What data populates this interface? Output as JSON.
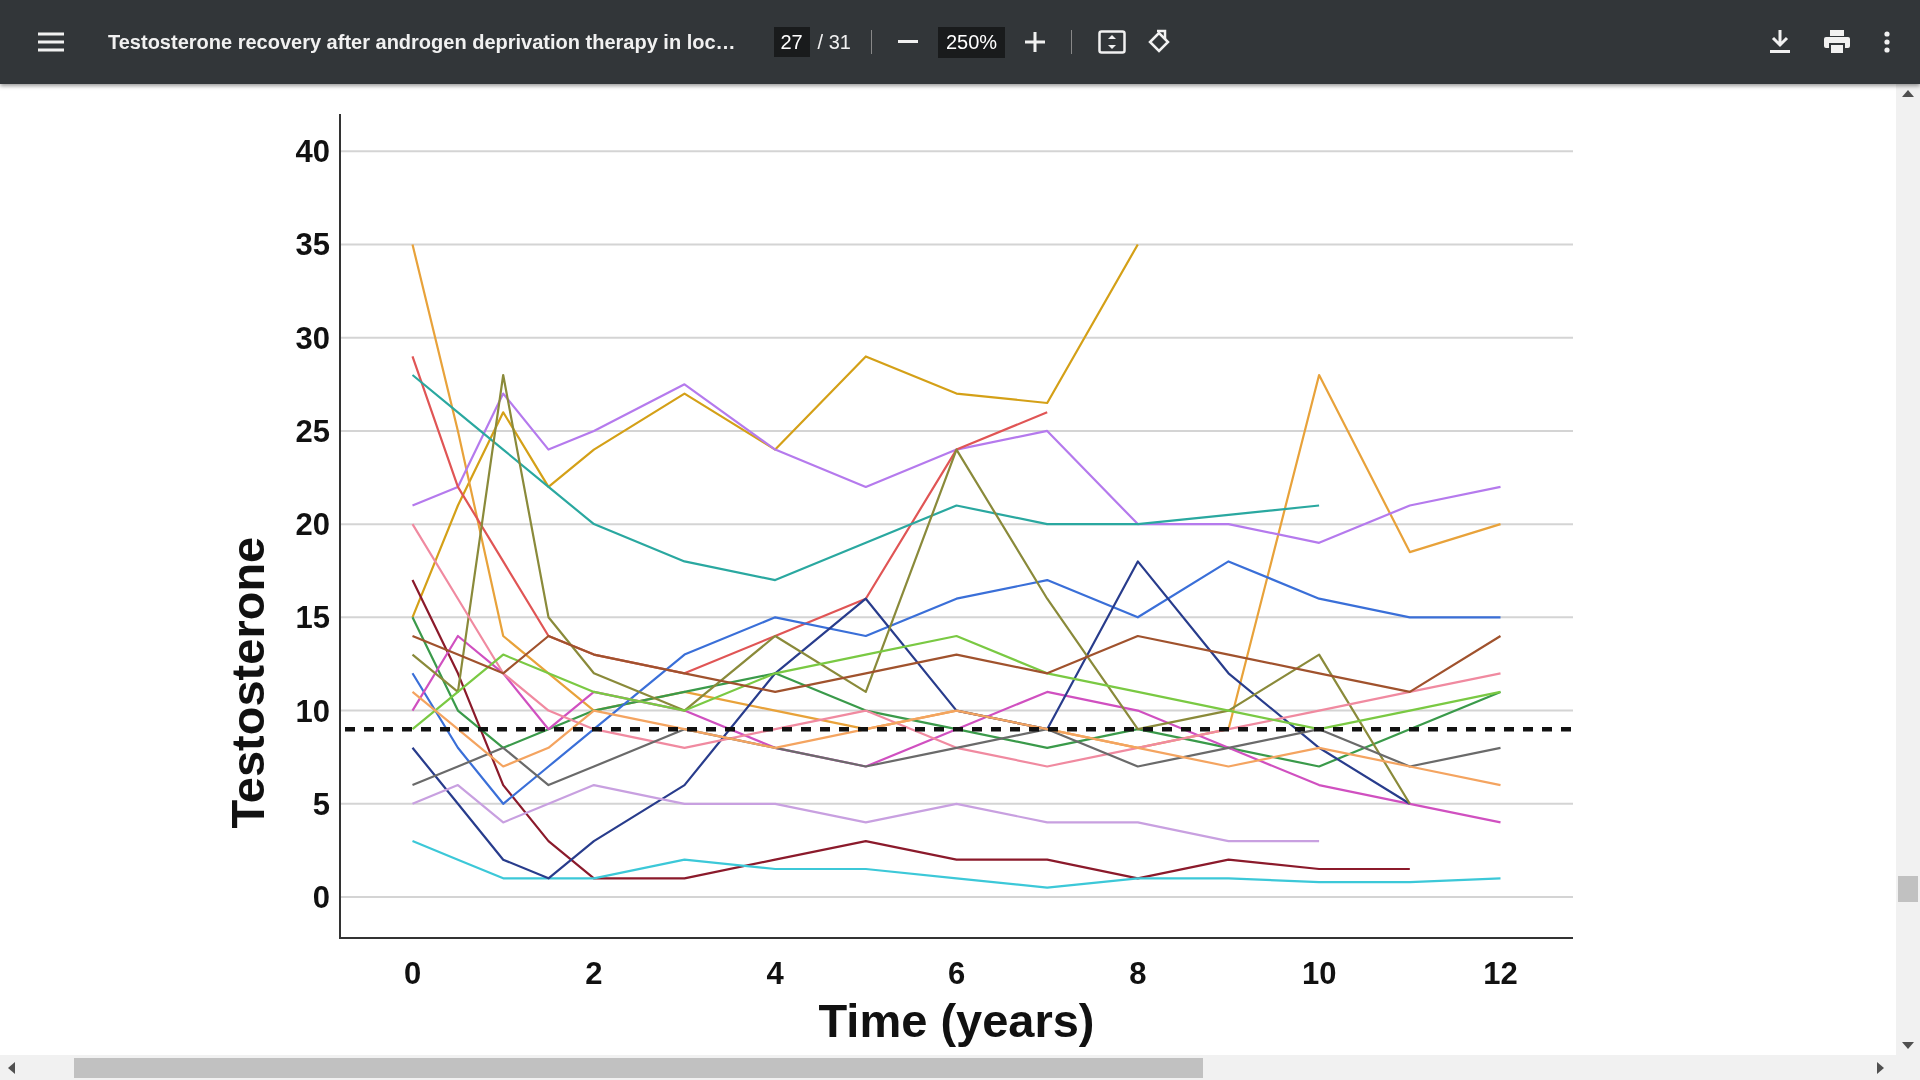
{
  "toolbar": {
    "title": "Testosterone recovery after androgen deprivation therapy in loc…",
    "page_number": "27",
    "page_count": "/ 31",
    "zoom": "250%"
  },
  "document": {
    "chart_data": {
      "type": "line",
      "xlabel": "Time (years)",
      "ylabel": "Testosterone",
      "x": [
        0,
        0.5,
        1,
        1.5,
        2,
        3,
        4,
        5,
        6,
        7,
        8,
        9,
        10,
        11,
        12
      ],
      "xticks": [
        0,
        2,
        4,
        6,
        8,
        10,
        12
      ],
      "yticks": [
        0,
        5,
        10,
        15,
        20,
        25,
        30,
        35,
        40
      ],
      "xlim": [
        -0.8,
        12.8
      ],
      "ylim": [
        -2.2,
        42
      ],
      "series": [
        {
          "color": "#d4a017",
          "values": [
            15,
            21,
            26,
            22,
            24,
            27,
            24,
            29,
            27,
            26.5,
            35,
            null,
            null,
            null,
            null
          ]
        },
        {
          "color": "#e8a23a",
          "values": [
            35,
            25,
            14,
            12,
            10,
            11,
            10,
            9,
            10,
            9,
            8,
            9,
            28,
            18.5,
            20
          ]
        },
        {
          "color": "#b57aed",
          "values": [
            21,
            22,
            27,
            24,
            25,
            27.5,
            24,
            22,
            24,
            25,
            20,
            20,
            19,
            21,
            22
          ]
        },
        {
          "color": "#e05555",
          "values": [
            29,
            22,
            18,
            14,
            13,
            12,
            14,
            16,
            24,
            26,
            null,
            null,
            null,
            null,
            null
          ]
        },
        {
          "color": "#2aa8a0",
          "values": [
            28,
            26,
            24,
            22,
            20,
            18,
            17,
            19,
            21,
            20,
            20,
            20.5,
            21,
            null,
            null
          ]
        },
        {
          "color": "#8b1a2b",
          "values": [
            17,
            12,
            6,
            3,
            1,
            1,
            2,
            3,
            2,
            2,
            1,
            2,
            1.5,
            1.5,
            null
          ]
        },
        {
          "color": "#3cc8d8",
          "values": [
            3,
            2,
            1,
            1,
            1,
            2,
            1.5,
            1.5,
            1,
            0.5,
            1,
            1,
            0.8,
            0.8,
            1
          ]
        },
        {
          "color": "#3a9a4a",
          "values": [
            15,
            10,
            8,
            9,
            10,
            11,
            12,
            10,
            9,
            8,
            9,
            8,
            7,
            9,
            11
          ]
        },
        {
          "color": "#3a6fd8",
          "values": [
            12,
            8,
            5,
            7,
            9,
            13,
            15,
            14,
            16,
            17,
            15,
            18,
            16,
            15,
            15
          ]
        },
        {
          "color": "#d050c0",
          "values": [
            10,
            14,
            12,
            9,
            11,
            10,
            8,
            7,
            9,
            11,
            10,
            8,
            6,
            5,
            4
          ]
        },
        {
          "color": "#283c8c",
          "values": [
            8,
            5,
            2,
            1,
            3,
            6,
            12,
            16,
            10,
            9,
            18,
            12,
            8,
            5,
            null
          ]
        },
        {
          "color": "#8a8a3a",
          "values": [
            13,
            11,
            28,
            15,
            12,
            10,
            14,
            11,
            24,
            16,
            9,
            10,
            13,
            5,
            null
          ]
        },
        {
          "color": "#f08aa0",
          "values": [
            20,
            16,
            12,
            10,
            9,
            8,
            9,
            10,
            8,
            7,
            8,
            9,
            10,
            11,
            12
          ]
        },
        {
          "color": "#6a6a6a",
          "values": [
            6,
            7,
            8,
            6,
            7,
            9,
            8,
            7,
            8,
            9,
            7,
            8,
            9,
            7,
            8
          ]
        },
        {
          "color": "#7ac943",
          "values": [
            9,
            11,
            13,
            12,
            11,
            10,
            12,
            13,
            14,
            12,
            11,
            10,
            9,
            10,
            11
          ]
        },
        {
          "color": "#a0522d",
          "values": [
            14,
            13,
            12,
            14,
            13,
            12,
            11,
            12,
            13,
            12,
            14,
            13,
            12,
            11,
            14
          ]
        },
        {
          "color": "#c8a0e0",
          "values": [
            5,
            6,
            4,
            5,
            6,
            5,
            5,
            4,
            5,
            4,
            4,
            3,
            3,
            null,
            null
          ]
        },
        {
          "color": "#f4a460",
          "values": [
            11,
            9,
            7,
            8,
            10,
            9,
            8,
            9,
            10,
            9,
            8,
            7,
            8,
            7,
            6
          ]
        }
      ],
      "grid": true,
      "ref_lines": [
        {
          "axis": "y",
          "value": 9
        }
      ]
    }
  }
}
